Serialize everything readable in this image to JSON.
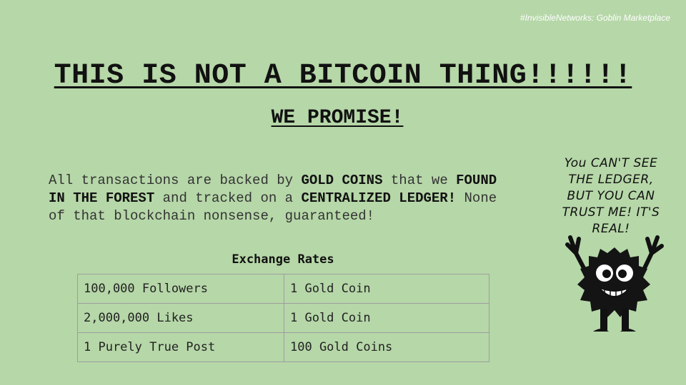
{
  "header": {
    "tag": "#InvisibleNetworks: Goblin Marketplace"
  },
  "title": "THIS IS NOT A BITCOIN THING!!!!!!",
  "subtitle": "WE PROMISE!",
  "body": {
    "p1": "All transactions are backed by ",
    "b1": "GOLD COINS",
    "p2": " that we ",
    "b2": "FOUND IN THE FOREST",
    "p3": " and tracked on a ",
    "b3": "CENTRALIZED LEDGER!",
    "p4": " None of that blockchain nonsense, guaranteed!"
  },
  "rates": {
    "title": "Exchange Rates",
    "rows": [
      [
        "100,000 Followers",
        "1 Gold Coin"
      ],
      [
        "2,000,000 Likes",
        "1 Gold Coin"
      ],
      [
        "1 Purely True Post",
        "100 Gold Coins"
      ]
    ]
  },
  "speech_bubble": {
    "lines": [
      "You CAN'T SEE",
      "THE LEDGER,",
      "BUT YOU CAN",
      "TRUST ME! IT'S",
      "REAL!"
    ]
  },
  "icons": {
    "mascot": "goblin-monster-icon"
  },
  "colors": {
    "background": "#b6d7a8",
    "text": "#111111"
  }
}
